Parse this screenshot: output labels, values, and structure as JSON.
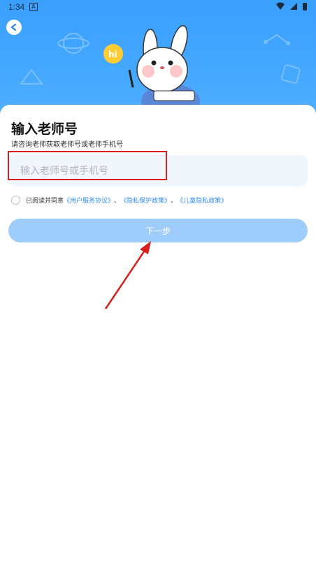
{
  "status": {
    "time": "1:34",
    "notif": "A"
  },
  "page": {
    "title": "输入老师号",
    "subtitle": "请咨询老师获取老师号或老师手机号"
  },
  "form": {
    "placeholder": "输入老师号或手机号",
    "agree_prefix": "已阅读并同意",
    "link1": "《用户服务协议》",
    "sep1": "、",
    "link2": "《隐私保护政策》",
    "sep2": "、",
    "link3": "《儿童隐私政策》",
    "next_label": "下一步"
  },
  "mascot": {
    "bubble_text": "hi"
  },
  "colors": {
    "primary": "#3aa0ff",
    "button_disabled": "#9fcdfb",
    "link": "#2f8cf3",
    "annotation": "#d81e1e"
  }
}
